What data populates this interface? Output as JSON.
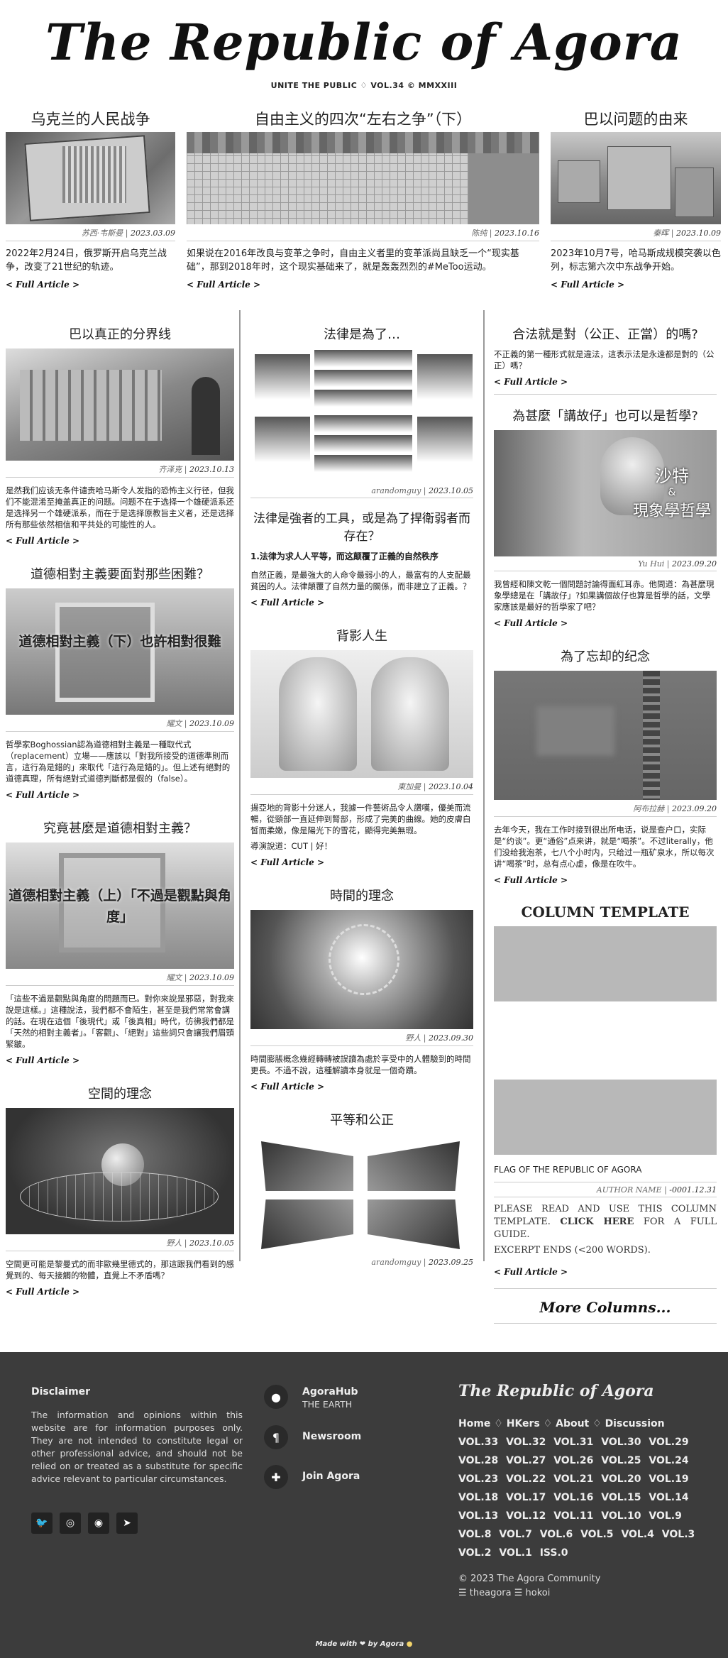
{
  "masthead": {
    "title": "The Republic of Agora",
    "subtitle": "UNITE THE PUBLIC ♢ VOL.34 © MMXXIII"
  },
  "top_articles": [
    {
      "title": "乌克兰的人民战争",
      "author": "苏西·韦斯曼",
      "date": "2023.03.09",
      "excerpt": "2022年2月24日，俄罗斯开启乌克兰战争，改变了21世纪的轨迹。",
      "link": "< Full Article >"
    },
    {
      "title": "自由主义的四次“左右之争”（下）",
      "author": "陈纯",
      "date": "2023.10.16",
      "excerpt": "如果说在2016年改良与变革之争时，自由主义者里的变革派尚且缺乏一个“现实基础”，那到2018年时，这个现实基础来了，就是轰轰烈烈的#MeToo运动。",
      "link": "< Full Article >"
    },
    {
      "title": "巴以问题的由来",
      "author": "秦晖",
      "date": "2023.10.09",
      "excerpt": "2023年10月7号，哈马斯成规模突袭以色列，标志第六次中东战争开始。",
      "link": "< Full Article >"
    }
  ],
  "col1": [
    {
      "title": "巴以真正的分界线",
      "author": "齐泽克",
      "date": "2023.10.13",
      "excerpt": "是然我们应该无条件谴责哈马斯令人发指的恐怖主义行径，但我们不能混淆至掩盖真正的问题。问题不在于选择一个雄硬派系还是选择另一个雄硬派系，而在于是选择原教旨主义者，还是选择所有那些依然相信和平共处的可能性的人。",
      "link": "< Full Article >"
    },
    {
      "title": "道德相對主義要面對那些困難？",
      "overlay": "道德相對主義（下）也許相對很難",
      "author": "耀文",
      "date": "2023.10.09",
      "excerpt": "哲學家Boghossian認為道德相對主義是一種取代式（replacement）立場——應該以「對我所接受的道德準則而言，這行為是錯的」來取代「這行為是錯的」。但上述有絕對的道德真理，所有絕對式道德判斷都是假的（false）。",
      "link": "< Full Article >"
    },
    {
      "title": "究竟甚麼是道德相對主義？",
      "overlay": "道德相對主義（上）「不過是觀點與角度」",
      "author": "耀文",
      "date": "2023.10.09",
      "excerpt": "「這些不過是觀點與角度的問題而已。對你來說是邪惡，對我來說是這樣。」這種說法，我們都不會陌生，甚至是我們常常會講的話。在現在這個「後現代」或「後真相」時代，彷彿我們都是「天然的相對主義者」。「客觀」、「絕對」這些詞只會讓我們眉頭緊皺。",
      "link": "< Full Article >"
    },
    {
      "title": "空間的理念",
      "author": "野人",
      "date": "2023.10.05",
      "excerpt": "空間更可能是黎曼式的而非歐幾里德式的，那這跟我們看到的感覺到的、每天接觸的物體，直覺上不矛盾嗎？",
      "link": "< Full Article >"
    }
  ],
  "col2": [
    {
      "title": "法律是為了…",
      "subtitle": "法律是強者的工具，或是為了捍衛弱者而存在？",
      "author": "arandomguy",
      "date": "2023.10.05",
      "bold": "1.法律为求人人平等，而这颠覆了正義的自然秩序",
      "excerpt": "自然正義，是最強大的人命令最弱小的人，最富有的人支配最貧困的人。法律顛覆了自然力量的關係，而非建立了正義。？",
      "link": "< Full Article >"
    },
    {
      "title": "背影人生",
      "author": "東加曼",
      "date": "2023.10.04",
      "excerpt": "揚亞地的背影十分迷人，我據一件藝術品令人讚嘆，優美而流暢，從頸部一直延伸到腎部，形成了完美的曲線。她的皮膚白皙而柔嫩，像是陽光下的雪花，顯得完美無瑕。",
      "extra": "導演說道：CUT | 好！",
      "link": "< Full Article >"
    },
    {
      "title": "時間的理念",
      "author": "野人",
      "date": "2023.09.30",
      "excerpt": "時間膨脹概念幾經轉轉被誤讀為處於享受中的人體驗到的時間更長。不過不說，這種解讀本身就是一個奇蹟。",
      "link": "< Full Article >"
    },
    {
      "title": "平等和公正",
      "author": "arandomguy",
      "date": "2023.09.25"
    }
  ],
  "col3": [
    {
      "title": "合法就是對（公正、正當）的嗎?",
      "excerpt": "不正義的第一種形式就是違法，這表示法是永遠都是對的（公正）嗎？",
      "link": "< Full Article >"
    },
    {
      "title": "為甚麼「講故仔」也可以是哲學?",
      "overlay1": "沙特",
      "overlay2": "&",
      "overlay3": "現象學哲學",
      "author": "Yu Hui",
      "date": "2023.09.20",
      "excerpt": "我曾經和陳文乾一個問題討論得面紅耳赤。他問道：為甚麼現象學總是在「講故仔」?如果講個故仔也算是哲學的話，文學家應該是最好的哲學家了吧？",
      "link": "< Full Article >"
    },
    {
      "title": "為了忘却的纪念",
      "author": "阿布拉赫",
      "date": "2023.09.20",
      "excerpt": "去年今天，我在工作时接到很出所电话，说是查户口，实际是“约谈”。更“通俗”点来讲，就是“喝茶”。不过literally，他们没给我泡茶，七八个小时内，只给过一瓶矿泉水，所以每次讲“喝茶”时，总有点心虚，像是在吹牛。",
      "link": "< Full Article >"
    },
    {
      "title": "COLUMN TEMPLATE",
      "flag": "FLAG OF THE REPUBLIC OF AGORA",
      "author": "AUTHOR NAME",
      "date": "-0001.12.31",
      "t1": "PLEASE READ AND USE THIS COLUMN TEMPLATE.",
      "t2": "CLICK HERE",
      "t3": "FOR A FULL GUIDE.",
      "t4": "EXCERPT ENDS (<200 WORDS).",
      "link": "< Full Article >"
    },
    {
      "more": "More Columns..."
    }
  ],
  "footer": {
    "disclaimer_title": "Disclaimer",
    "disclaimer": "The information and opinions within this website are for information purposes only. They are not intended to constitute legal or other professional advice, and should not be relied on or treated as a substitute for specific advice relevant to particular circumstances.",
    "contacts": [
      {
        "title": "AgoraHub",
        "sub": "THE EARTH",
        "icon": "map-pin-icon"
      },
      {
        "title": "Newsroom",
        "sub": "",
        "icon": "pilcrow-icon"
      },
      {
        "title": "Join Agora",
        "sub": "",
        "icon": "puzzle-icon"
      }
    ],
    "brand": "The Republic of Agora",
    "nav": [
      "Home",
      "HKers",
      "About",
      "Discussion"
    ],
    "vols": [
      "VOL.33",
      "VOL.32",
      "VOL.31",
      "VOL.30",
      "VOL.29",
      "VOL.28",
      "VOL.27",
      "VOL.26",
      "VOL.25",
      "VOL.24",
      "VOL.23",
      "VOL.22",
      "VOL.21",
      "VOL.20",
      "VOL.19",
      "VOL.18",
      "VOL.17",
      "VOL.16",
      "VOL.15",
      "VOL.14",
      "VOL.13",
      "VOL.12",
      "VOL.11",
      "VOL.10",
      "VOL.9",
      "VOL.8",
      "VOL.7",
      "VOL.6",
      "VOL.5",
      "VOL.4",
      "VOL.3",
      "VOL.2",
      "VOL.1",
      "ISS.0"
    ],
    "copyright": "© 2023 The Agora Community",
    "links": "☰ theagora ☰ hokoi",
    "made": "Made with",
    "made2": "by Agora"
  }
}
